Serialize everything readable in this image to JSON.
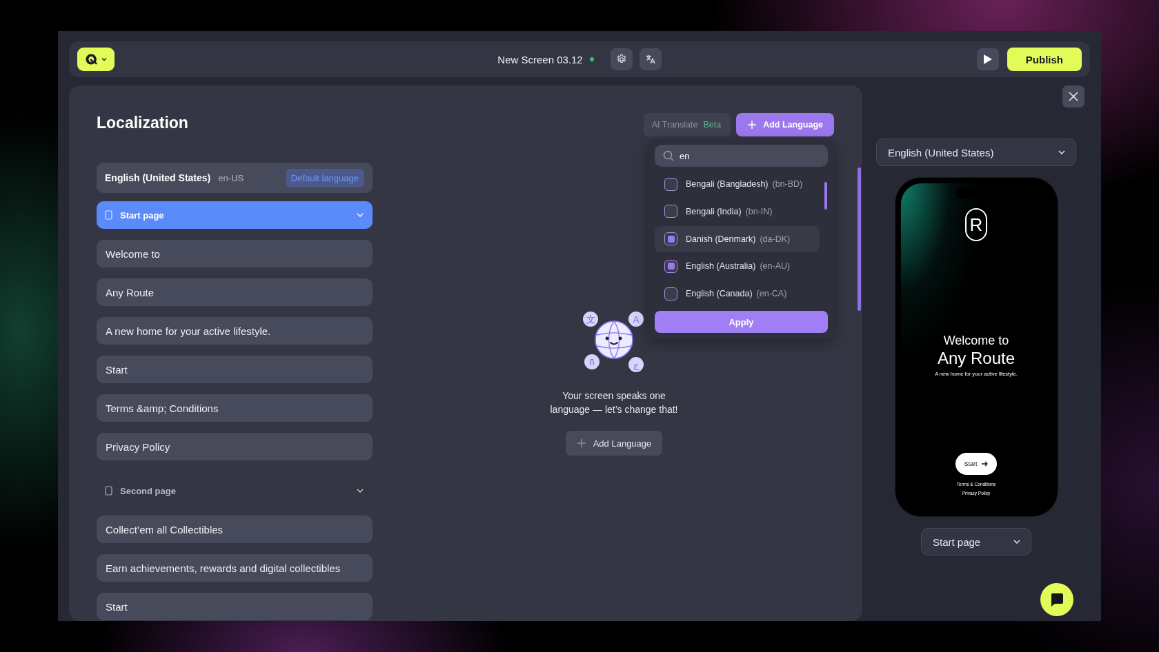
{
  "top_bar": {
    "title": "New Screen 03.12",
    "saved": true,
    "publish": "Publish"
  },
  "localization": {
    "title": "Localization",
    "default_language": {
      "name": "English (United States)",
      "code": "en-US",
      "badge": "Default language"
    },
    "pages": [
      {
        "title": "Start page",
        "selected": true,
        "expanded": true,
        "strings": [
          "Welcome to",
          "Any Route",
          "A new home for your active lifestyle.",
          "Start",
          "Terms &amp; Conditions",
          "Privacy Policy"
        ]
      },
      {
        "title": "Second page",
        "selected": false,
        "expanded": true,
        "strings": [
          "Collect’em all Collectibles",
          "Earn achievements, rewards and digital collectibles",
          "Start"
        ]
      }
    ]
  },
  "toolbar": {
    "ai_translate": {
      "label": "AI Translate",
      "badge": "Beta",
      "disabled": true
    },
    "add_language": "Add Language"
  },
  "language_picker": {
    "search": "en",
    "options": [
      {
        "name": "Bengali (Bangladesh)",
        "code": "(bn-BD)",
        "checked": false,
        "hovered": false
      },
      {
        "name": "Bengali (India)",
        "code": "(bn-IN)",
        "checked": false,
        "hovered": false
      },
      {
        "name": "Danish (Denmark)",
        "code": "(da-DK)",
        "checked": true,
        "hovered": true
      },
      {
        "name": "English (Australia)",
        "code": "(en-AU)",
        "checked": true,
        "hovered": false
      },
      {
        "name": "English (Canada)",
        "code": "(en-CA)",
        "checked": false,
        "hovered": false
      }
    ],
    "apply": "Apply"
  },
  "empty_state": {
    "glyphs": [
      "文",
      "A",
      "ñ",
      "ج"
    ],
    "message": "Your screen speaks one language — let’s change that!",
    "button": "Add Language"
  },
  "preview": {
    "language": "English (United States)",
    "logo_letter": "R",
    "heading": "Welcome to",
    "title": "Any Route",
    "subtitle": "A new home for your active lifestyle.",
    "start": "Start",
    "links": [
      "Terms & Conditions",
      "Privacy Policy"
    ],
    "page": "Start page"
  }
}
